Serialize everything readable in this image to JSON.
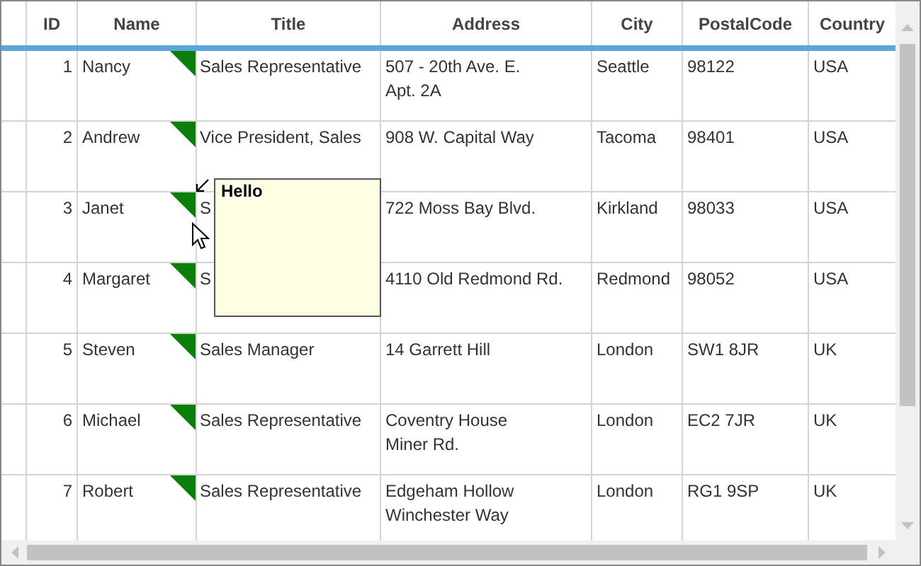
{
  "columns": [
    {
      "label": "ID"
    },
    {
      "label": "Name"
    },
    {
      "label": "Title"
    },
    {
      "label": "Address"
    },
    {
      "label": "City"
    },
    {
      "label": "PostalCode"
    },
    {
      "label": "Country"
    }
  ],
  "rows": [
    {
      "cells": [
        "1",
        "Nancy",
        "Sales Representative",
        "507 - 20th Ave. E.\nApt. 2A",
        "Seattle",
        "98122",
        "USA"
      ],
      "has_comment": true
    },
    {
      "cells": [
        "2",
        "Andrew",
        "Vice President, Sales",
        "908 W. Capital Way",
        "Tacoma",
        "98401",
        "USA"
      ],
      "has_comment": true
    },
    {
      "cells": [
        "3",
        "Janet",
        "S",
        "722 Moss Bay Blvd.",
        "Kirkland",
        "98033",
        "USA"
      ],
      "has_comment": true
    },
    {
      "cells": [
        "4",
        "Margaret",
        "S",
        "4110 Old Redmond Rd.",
        "Redmond",
        "98052",
        "USA"
      ],
      "has_comment": true
    },
    {
      "cells": [
        "5",
        "Steven",
        "Sales Manager",
        "14 Garrett Hill",
        "London",
        "SW1 8JR",
        "UK"
      ],
      "has_comment": true
    },
    {
      "cells": [
        "6",
        "Michael",
        "Sales Representative",
        "Coventry House\nMiner Rd.",
        "London",
        "EC2 7JR",
        "UK"
      ],
      "has_comment": true
    },
    {
      "cells": [
        "7",
        "Robert",
        "Sales Representative",
        "Edgeham Hollow\nWinchester Way",
        "London",
        "RG1 9SP",
        "UK"
      ],
      "has_comment": true
    }
  ],
  "comment_tooltip": {
    "text": "Hello"
  }
}
